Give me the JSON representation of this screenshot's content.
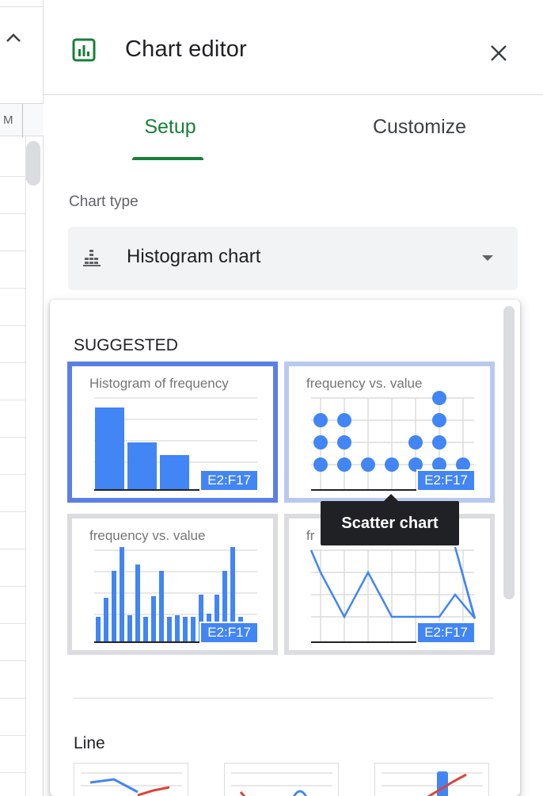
{
  "editor": {
    "title": "Chart editor",
    "tabs": {
      "setup": "Setup",
      "customize": "Customize"
    },
    "active_tab": "Setup",
    "chart_type_label": "Chart type",
    "chart_type_value": "Histogram chart"
  },
  "sheet": {
    "column_partial": "M"
  },
  "dropdown": {
    "suggested_heading": "SUGGESTED",
    "suggestions": [
      {
        "title": "Histogram of frequency",
        "range": "E2:F17",
        "state": "selected"
      },
      {
        "title": "frequency vs. value",
        "range": "E2:F17",
        "state": "hovered"
      },
      {
        "title": "frequency vs. value",
        "range": "E2:F17",
        "state": "normal"
      },
      {
        "title": "fr",
        "range": "E2:F17",
        "state": "normal"
      }
    ],
    "tooltip": "Scatter chart",
    "line_heading": "Line"
  },
  "colors": {
    "accent_green": "#188038",
    "chart_blue": "#4285f4",
    "selected_border": "#5b7fe4",
    "hover_border": "#b9c8ef",
    "line_red": "#db4437"
  },
  "icons": [
    "chart-editor-icon",
    "close-icon",
    "histogram-icon",
    "dropdown-arrow-icon",
    "collapse-up-icon"
  ]
}
